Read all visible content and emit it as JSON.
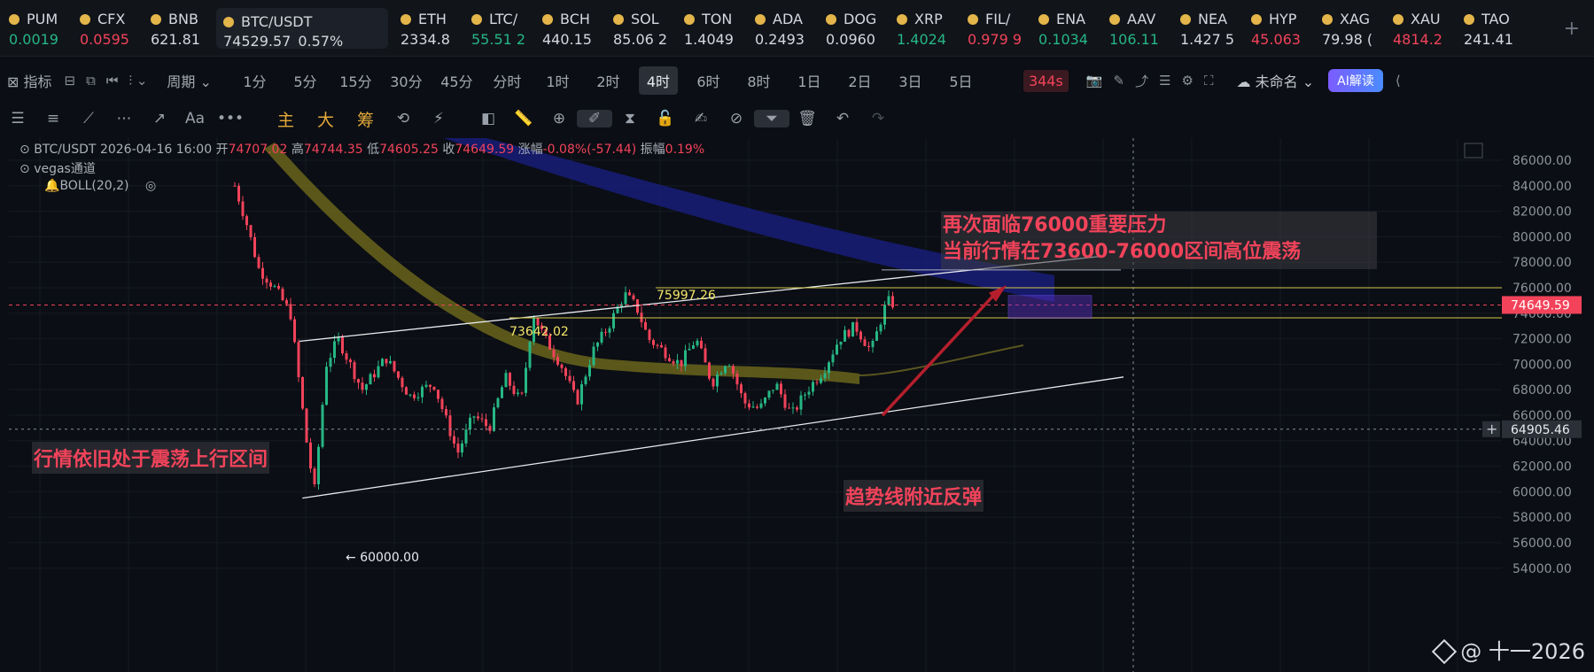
{
  "ticker": {
    "items": [
      {
        "symbol": "PUM",
        "price": "0.0019",
        "dir": "up"
      },
      {
        "symbol": "CFX",
        "price": "0.0595",
        "dir": "dn"
      },
      {
        "symbol": "BNB",
        "price": "621.81",
        "dir": "nt"
      },
      {
        "symbol": "BTC/USDT",
        "price": "74529.57",
        "change": "0.57%",
        "dir": "nt",
        "active": true
      },
      {
        "symbol": "ETH",
        "price": "2334.8",
        "dir": "nt"
      },
      {
        "symbol": "LTC/",
        "price": "55.51 2",
        "dir": "up"
      },
      {
        "symbol": "BCH",
        "price": "440.15",
        "dir": "nt"
      },
      {
        "symbol": "SOL",
        "price": "85.06 2",
        "dir": "nt"
      },
      {
        "symbol": "TON",
        "price": "1.4049",
        "dir": "nt"
      },
      {
        "symbol": "ADA",
        "price": "0.2493",
        "dir": "nt"
      },
      {
        "symbol": "DOG",
        "price": "0.0960",
        "dir": "nt"
      },
      {
        "symbol": "XRP",
        "price": "1.4024",
        "dir": "up"
      },
      {
        "symbol": "FIL/",
        "price": "0.979 9",
        "dir": "dn"
      },
      {
        "symbol": "ENA",
        "price": "0.1034",
        "dir": "up"
      },
      {
        "symbol": "AAV",
        "price": "106.11",
        "dir": "up"
      },
      {
        "symbol": "NEA",
        "price": "1.427 5",
        "dir": "nt"
      },
      {
        "symbol": "HYP",
        "price": "45.063",
        "dir": "dn"
      },
      {
        "symbol": "XAG",
        "price": "79.98 (",
        "dir": "nt"
      },
      {
        "symbol": "XAU",
        "price": "4814.2",
        "dir": "dn"
      },
      {
        "symbol": "TAO",
        "price": "241.41",
        "dir": "nt"
      }
    ],
    "add_icon": "plus-icon"
  },
  "toolbar1": {
    "indicators_label": "指标",
    "period_label": "周期",
    "intervals": [
      "1分",
      "5分",
      "15分",
      "30分",
      "45分",
      "分时",
      "1时",
      "2时",
      "4时",
      "6时",
      "8时",
      "1日",
      "2日",
      "3日",
      "5日"
    ],
    "selected_interval": "4时",
    "countdown": "344s",
    "layout_name": "未命名",
    "ai_label": "AI解读"
  },
  "toolbar2": {
    "main_label": "主",
    "large_label": "大",
    "chip_label": "筹"
  },
  "legend": {
    "symbol": "BTC/USDT",
    "datetime": "2026-04-16 16:00",
    "open_label": "开",
    "open": "74707.02",
    "high_label": "高",
    "high": "74744.35",
    "low_label": "低",
    "low": "74605.25",
    "close_label": "收",
    "close": "74649.59",
    "change_label": "涨幅",
    "change": "-0.08%(-57.44)",
    "amp_label": "振幅",
    "amp": "0.19%",
    "indicator1": "vegas通道",
    "indicator2": "BOLL(20,2)"
  },
  "annotations": {
    "top_line1": "再次面临76000重要压力",
    "top_line2": "当前行情在73600-76000区间高位震荡",
    "left": "行情依旧处于震荡上行区间",
    "bottom": "趋势线附近反弹",
    "level_high": "75997.26",
    "level_low": "73642.02",
    "low_point": "60000.00"
  },
  "price_axis": {
    "ticks": [
      "86000.00",
      "84000.00",
      "82000.00",
      "80000.00",
      "78000.00",
      "76000.00",
      "74000.00",
      "72000.00",
      "70000.00",
      "68000.00",
      "66000.00",
      "64000.00",
      "62000.00",
      "60000.00",
      "58000.00",
      "56000.00",
      "54000.00"
    ],
    "current_price": "74649.59",
    "crosshair_price": "64905.46",
    "colors": {
      "current": "#f2435a",
      "up": "#26b684",
      "down": "#f2435a"
    }
  },
  "watermark": {
    "text": "@ 十一2026"
  },
  "chart_data": {
    "type": "candlestick",
    "symbol": "BTC/USDT",
    "interval": "4时",
    "ylim": [
      54000,
      87000
    ],
    "last_close": 74649.59,
    "resistance_levels": [
      75997.26,
      73642.02
    ],
    "marked_low": 60000.0,
    "crosshair_value": 64905.46,
    "path_keypoints": [
      {
        "x": 0,
        "y": 84000
      },
      {
        "x": 3,
        "y": 81000
      },
      {
        "x": 6,
        "y": 77500
      },
      {
        "x": 10,
        "y": 76000
      },
      {
        "x": 14,
        "y": 74000
      },
      {
        "x": 18,
        "y": 64000
      },
      {
        "x": 20,
        "y": 60000
      },
      {
        "x": 23,
        "y": 70000
      },
      {
        "x": 26,
        "y": 72000
      },
      {
        "x": 32,
        "y": 68000
      },
      {
        "x": 38,
        "y": 70500
      },
      {
        "x": 44,
        "y": 67500
      },
      {
        "x": 50,
        "y": 68500
      },
      {
        "x": 56,
        "y": 63000
      },
      {
        "x": 60,
        "y": 66000
      },
      {
        "x": 64,
        "y": 65000
      },
      {
        "x": 68,
        "y": 69000
      },
      {
        "x": 72,
        "y": 67000
      },
      {
        "x": 75,
        "y": 74000
      },
      {
        "x": 78,
        "y": 72000
      },
      {
        "x": 82,
        "y": 70000
      },
      {
        "x": 86,
        "y": 67000
      },
      {
        "x": 90,
        "y": 71000
      },
      {
        "x": 94,
        "y": 73000
      },
      {
        "x": 98,
        "y": 75500
      },
      {
        "x": 101,
        "y": 74500
      },
      {
        "x": 104,
        "y": 72000
      },
      {
        "x": 108,
        "y": 71000
      },
      {
        "x": 112,
        "y": 70000
      },
      {
        "x": 116,
        "y": 72000
      },
      {
        "x": 120,
        "y": 68500
      },
      {
        "x": 124,
        "y": 70500
      },
      {
        "x": 128,
        "y": 67000
      },
      {
        "x": 132,
        "y": 66500
      },
      {
        "x": 136,
        "y": 68500
      },
      {
        "x": 140,
        "y": 66000
      },
      {
        "x": 144,
        "y": 68000
      },
      {
        "x": 148,
        "y": 69500
      },
      {
        "x": 152,
        "y": 72000
      },
      {
        "x": 156,
        "y": 73000
      },
      {
        "x": 160,
        "y": 71000
      },
      {
        "x": 164,
        "y": 75000
      },
      {
        "x": 166,
        "y": 74649
      }
    ],
    "trend_upper": [
      {
        "x": 14,
        "y": 71800
      },
      {
        "x": 152,
        "y": 78500
      }
    ],
    "trend_lower": [
      {
        "x": 17,
        "y": 59500
      },
      {
        "x": 177,
        "y": 69000
      }
    ]
  }
}
